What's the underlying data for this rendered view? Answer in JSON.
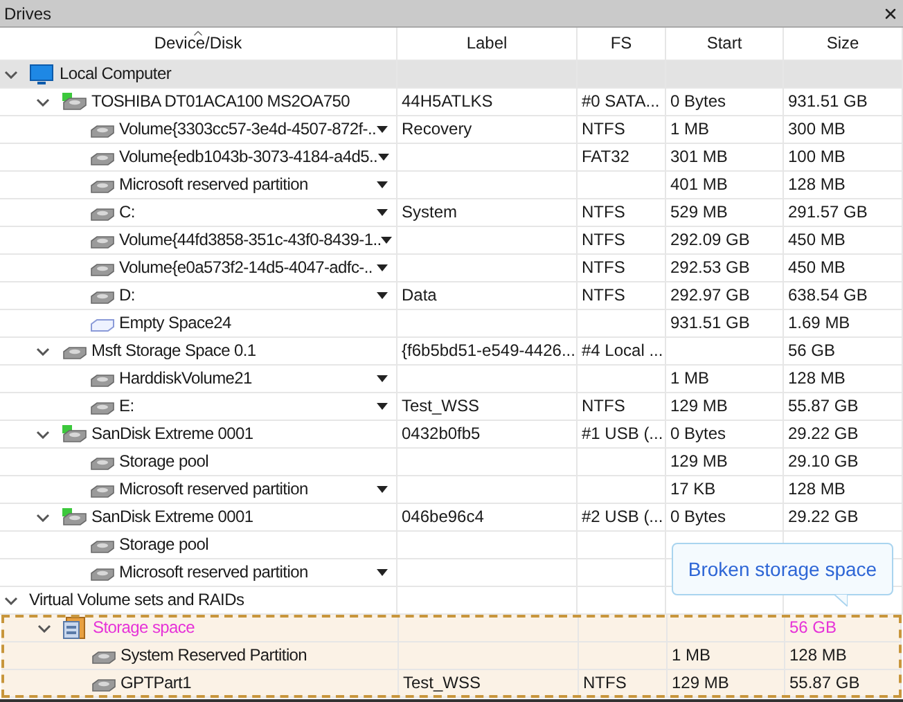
{
  "panel": {
    "title": "Drives"
  },
  "columns": [
    {
      "label": "Device/Disk",
      "sorted": true
    },
    {
      "label": "Label",
      "sorted": false
    },
    {
      "label": "FS",
      "sorted": false
    },
    {
      "label": "Start",
      "sorted": false
    },
    {
      "label": "Size",
      "sorted": false
    }
  ],
  "tree": [
    {
      "kind": "computer",
      "name": "Local Computer",
      "expanded": true,
      "selected": true,
      "children": [
        {
          "kind": "disk",
          "name": "TOSHIBA DT01ACA100 MS2OA750",
          "label": "44H5ATLKS",
          "fs": "#0 SATA...",
          "start": "0 Bytes",
          "size": "931.51 GB",
          "expanded": true,
          "menu": false,
          "children": [
            {
              "kind": "volume",
              "name": "Volume{3303cc57-3e4d-4507-872f-..",
              "label": "Recovery",
              "fs": "NTFS",
              "start": "1 MB",
              "size": "300 MB",
              "menu": true
            },
            {
              "kind": "volume",
              "name": "Volume{edb1043b-3073-4184-a4d5..",
              "fs": "FAT32",
              "start": "301 MB",
              "size": "100 MB",
              "menu": true
            },
            {
              "kind": "volume",
              "name": "Microsoft reserved partition",
              "start": "401 MB",
              "size": "128 MB",
              "menu": true
            },
            {
              "kind": "volume",
              "name": "C:",
              "label": "System",
              "fs": "NTFS",
              "start": "529 MB",
              "size": "291.57 GB",
              "menu": true
            },
            {
              "kind": "volume",
              "name": "Volume{44fd3858-351c-43f0-8439-1..",
              "fs": "NTFS",
              "start": "292.09 GB",
              "size": "450 MB",
              "menu": true
            },
            {
              "kind": "volume",
              "name": "Volume{e0a573f2-14d5-4047-adfc-..",
              "fs": "NTFS",
              "start": "292.53 GB",
              "size": "450 MB",
              "menu": true
            },
            {
              "kind": "volume",
              "name": "D:",
              "label": "Data",
              "fs": "NTFS",
              "start": "292.97 GB",
              "size": "638.54 GB",
              "menu": true
            },
            {
              "kind": "empty",
              "name": "Empty Space24",
              "start": "931.51 GB",
              "size": "1.69 MB",
              "menu": false
            }
          ]
        },
        {
          "kind": "vdisk",
          "name": "Msft Storage Space 0.1",
          "label": "{f6b5bd51-e549-4426...",
          "fs": "#4 Local ...",
          "size": "56 GB",
          "expanded": true,
          "menu": false,
          "children": [
            {
              "kind": "volume",
              "name": "HarddiskVolume21",
              "start": "1 MB",
              "size": "128 MB",
              "menu": true
            },
            {
              "kind": "volume",
              "name": "E:",
              "label": "Test_WSS",
              "fs": "NTFS",
              "start": "129 MB",
              "size": "55.87 GB",
              "menu": true
            }
          ]
        },
        {
          "kind": "disk",
          "name": "SanDisk Extreme 0001",
          "label": "0432b0fb5",
          "fs": "#1 USB (...",
          "start": "0 Bytes",
          "size": "29.22 GB",
          "expanded": true,
          "menu": false,
          "children": [
            {
              "kind": "volume",
              "name": "Storage pool",
              "start": "129 MB",
              "size": "29.10 GB",
              "menu": false
            },
            {
              "kind": "volume",
              "name": "Microsoft reserved partition",
              "start": "17 KB",
              "size": "128 MB",
              "menu": true
            }
          ]
        },
        {
          "kind": "disk",
          "name": "SanDisk Extreme 0001",
          "label": "046be96c4",
          "fs": "#2 USB (...",
          "start": "0 Bytes",
          "size": "29.22 GB",
          "expanded": true,
          "menu": false,
          "children": [
            {
              "kind": "volume",
              "name": "Storage pool",
              "menu": false
            },
            {
              "kind": "volume",
              "name": "Microsoft reserved partition",
              "menu": true
            }
          ]
        }
      ]
    },
    {
      "kind": "group",
      "name": "Virtual Volume sets and RAIDs",
      "expanded": true,
      "selected": false,
      "children": [
        {
          "kind": "space",
          "name": "Storage space",
          "size": "56 GB",
          "expanded": true,
          "broken": true,
          "menu": false,
          "children": [
            {
              "kind": "volume",
              "name": "System Reserved Partition",
              "start": "1 MB",
              "size": "128 MB",
              "menu": false
            },
            {
              "kind": "volume",
              "name": "GPTPart1",
              "label": "Test_WSS",
              "fs": "NTFS",
              "start": "129 MB",
              "size": "55.87 GB",
              "menu": false
            }
          ]
        }
      ]
    }
  ],
  "tooltip": {
    "text": "Broken storage space"
  }
}
